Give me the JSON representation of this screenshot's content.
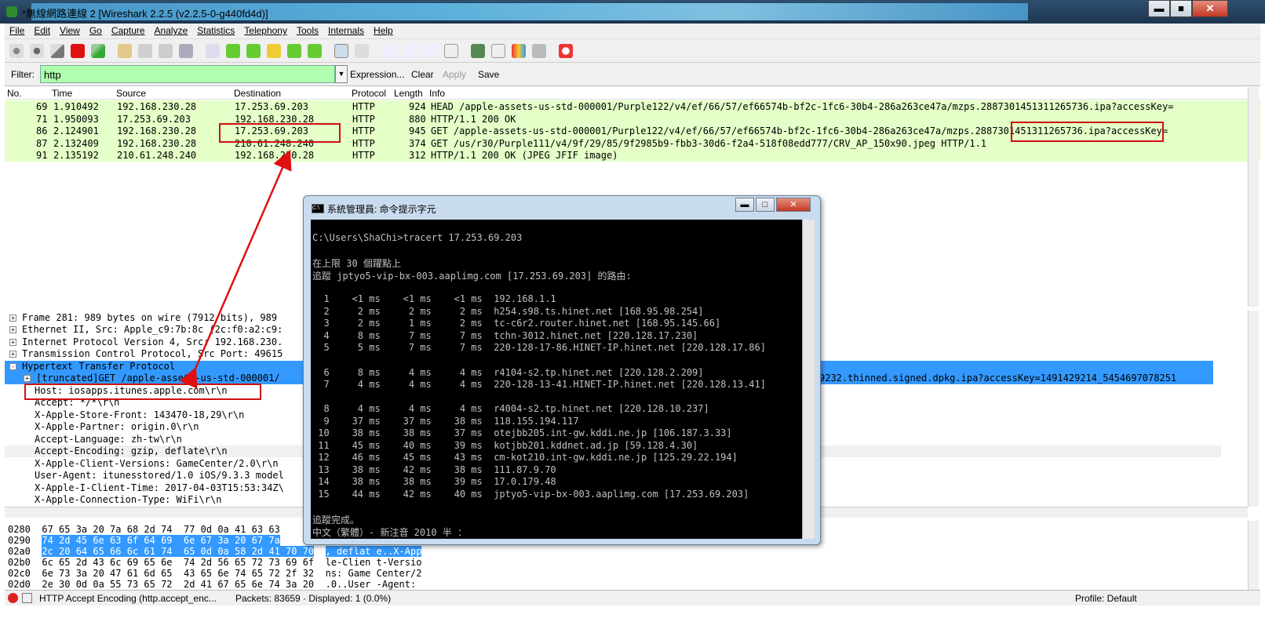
{
  "window": {
    "title": "*無線網路連線 2 [Wireshark 2.2.5 (v2.2.5-0-g440fd4d)]",
    "min": "▬",
    "max": "■",
    "close": "✕"
  },
  "menu": [
    "File",
    "Edit",
    "View",
    "Go",
    "Capture",
    "Analyze",
    "Statistics",
    "Telephony",
    "Tools",
    "Internals",
    "Help"
  ],
  "filter": {
    "label": "Filter:",
    "value": "http",
    "expression": "Expression...",
    "clear": "Clear",
    "apply": "Apply",
    "save": "Save"
  },
  "columns": {
    "no": "No.",
    "time": "Time",
    "source": "Source",
    "destination": "Destination",
    "protocol": "Protocol",
    "length": "Length",
    "info": "Info"
  },
  "packets": [
    {
      "no": "69",
      "time": "1.910492",
      "src": "192.168.230.28",
      "dst": "17.253.69.203",
      "proto": "HTTP",
      "len": "924",
      "info": "HEAD /apple-assets-us-std-000001/Purple122/v4/ef/66/57/ef66574b-bf2c-1fc6-30b4-286a263ce47a/mzps.2887301451311265736.ipa?accessKey="
    },
    {
      "no": "71",
      "time": "1.950093",
      "src": "17.253.69.203",
      "dst": "192.168.230.28",
      "proto": "HTTP",
      "len": "880",
      "info": "HTTP/1.1 200 OK"
    },
    {
      "no": "86",
      "time": "2.124901",
      "src": "192.168.230.28",
      "dst": "17.253.69.203",
      "proto": "HTTP",
      "len": "945",
      "info": "GET /apple-assets-us-std-000001/Purple122/v4/ef/66/57/ef66574b-bf2c-1fc6-30b4-286a263ce47a/mzps.2887301451311265736.ipa?accessKey="
    },
    {
      "no": "87",
      "time": "2.132409",
      "src": "192.168.230.28",
      "dst": "210.61.248.240",
      "proto": "HTTP",
      "len": "374",
      "info": "GET /us/r30/Purple111/v4/9f/29/85/9f2985b9-fbb3-30d6-f2a4-518f08edd777/CRV_AP_150x90.jpeg HTTP/1.1"
    },
    {
      "no": "91",
      "time": "2.135192",
      "src": "210.61.248.240",
      "dst": "192.168.230.28",
      "proto": "HTTP",
      "len": "312",
      "info": "HTTP/1.1 200 OK  (JPEG JFIF image)"
    }
  ],
  "details": [
    {
      "exp": "+",
      "text": "Frame 281: 989 bytes on wire (7912 bits), 989"
    },
    {
      "exp": "+",
      "text": "Ethernet II, Src: Apple_c9:7b:8c (2c:f0:a2:c9:"
    },
    {
      "exp": "+",
      "text": "Internet Protocol Version 4, Src: 192.168.230."
    },
    {
      "exp": "+",
      "text": "Transmission Control Protocol, Src Port: 49615"
    },
    {
      "exp": "-",
      "text": "Hypertext Transfer Protocol"
    },
    {
      "exp": "+",
      "text": "[truncated]GET /apple-assets-us-std-000001/"
    },
    {
      "exp": "",
      "text": "Host: iosapps.itunes.apple.com\\r\\n"
    },
    {
      "exp": "",
      "text": "Accept: */*\\r\\n"
    },
    {
      "exp": "",
      "text": "X-Apple-Store-Front: 143470-18,29\\r\\n"
    },
    {
      "exp": "",
      "text": "X-Apple-Partner: origin.0\\r\\n"
    },
    {
      "exp": "",
      "text": "Accept-Language: zh-tw\\r\\n"
    },
    {
      "exp": "",
      "text": "Accept-Encoding: gzip, deflate\\r\\n"
    },
    {
      "exp": "",
      "text": "X-Apple-Client-Versions: GameCenter/2.0\\r\\n"
    },
    {
      "exp": "",
      "text": "User-Agent: itunesstored/1.0 iOS/9.3.3 model"
    },
    {
      "exp": "",
      "text": "X-Apple-I-Client-Time: 2017-04-03T15:53:34Z\\"
    },
    {
      "exp": "",
      "text": "X-Apple-Connection-Type: WiFi\\r\\n"
    }
  ],
  "truncated_tail": "9232.thinned.signed.dpkg.ipa?accessKey=1491429214_5454697078251",
  "hex": [
    {
      "off": "0280",
      "bytes": "67 65 3a 20 7a 68 2d 74  77 0d 0a 41 63 63",
      "ascii": ""
    },
    {
      "off": "0290",
      "bytes": "74 2d 45 6e 63 6f 64 69  6e 67 3a 20 67 7a",
      "ascii": ""
    },
    {
      "off": "02a0",
      "bytes": "2c 20 64 65 66 6c 61 74  65 0d 0a 58 2d 41 70 70",
      "ascii": ", deflat e..X-App"
    },
    {
      "off": "02b0",
      "bytes": "6c 65 2d 43 6c 69 65 6e  74 2d 56 65 72 73 69 6f",
      "ascii": "le-Clien t-Versio"
    },
    {
      "off": "02c0",
      "bytes": "6e 73 3a 20 47 61 6d 65  43 65 6e 74 65 72 2f 32",
      "ascii": "ns: Game Center/2"
    },
    {
      "off": "02d0",
      "bytes": "2e 30 0d 0a 55 73 65 72  2d 41 67 65 6e 74 3a 20",
      "ascii": ".0..User -Agent: "
    }
  ],
  "status": {
    "field": "HTTP Accept Encoding (http.accept_enc...",
    "packets": "Packets: 83659 · Displayed: 1 (0.0%)",
    "profile": "Profile: Default"
  },
  "cmd": {
    "title": "系統管理員: 命令提示字元",
    "icon": "C:\\",
    "lines": [
      "C:\\Users\\ShaChi>tracert 17.253.69.203",
      "",
      "在上限 30 個躍點上",
      "追蹤 jptyo5-vip-bx-003.aaplimg.com [17.253.69.203] 的路由:",
      "",
      "  1    <1 ms    <1 ms    <1 ms  192.168.1.1",
      "  2     2 ms     2 ms     2 ms  h254.s98.ts.hinet.net [168.95.98.254]",
      "  3     2 ms     1 ms     2 ms  tc-c6r2.router.hinet.net [168.95.145.66]",
      "  4     8 ms     7 ms     7 ms  tchn-3012.hinet.net [220.128.17.230]",
      "  5     5 ms     7 ms     7 ms  220-128-17-86.HINET-IP.hinet.net [220.128.17.86]",
      "",
      "  6     8 ms     4 ms     4 ms  r4104-s2.tp.hinet.net [220.128.2.209]",
      "  7     4 ms     4 ms     4 ms  220-128-13-41.HINET-IP.hinet.net [220.128.13.41]",
      "",
      "  8     4 ms     4 ms     4 ms  r4004-s2.tp.hinet.net [220.128.10.237]",
      "  9    37 ms    37 ms    38 ms  118.155.194.117",
      " 10    38 ms    38 ms    37 ms  otejbb205.int-gw.kddi.ne.jp [106.187.3.33]",
      " 11    45 ms    40 ms    39 ms  kotjbb201.kddnet.ad.jp [59.128.4.30]",
      " 12    46 ms    45 ms    43 ms  cm-kot210.int-gw.kddi.ne.jp [125.29.22.194]",
      " 13    38 ms    42 ms    38 ms  111.87.9.70",
      " 14    38 ms    38 ms    39 ms  17.0.179.48",
      " 15    44 ms    42 ms    40 ms  jptyo5-vip-bx-003.aaplimg.com [17.253.69.203]",
      "",
      "追蹤完成。",
      "中文（繁體）- 新注音 2010 半 ："
    ]
  }
}
